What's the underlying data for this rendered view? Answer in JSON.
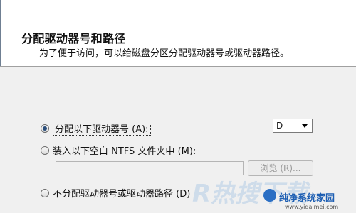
{
  "header": {
    "title": "分配驱动器号和路径",
    "subtitle": "为了便于访问，可以给磁盘分区分配驱动器号或驱动器路径。"
  },
  "options": {
    "assign_letter": {
      "label": "分配以下驱动器号 (A):",
      "selected": true
    },
    "mount_folder": {
      "label": "装入以下空白 NTFS 文件夹中 (M):",
      "selected": false
    },
    "no_assign": {
      "label": "不分配驱动器号或驱动器路径 (D)",
      "selected": false
    }
  },
  "drive_select": {
    "value": "D"
  },
  "folder_path": {
    "value": "",
    "browse_label": "浏览 (R)..."
  },
  "watermark": {
    "mark": "R热搜下载",
    "site_name": "纯净系统家园",
    "site_url": "www.yidaimei.com",
    "color": "#1e5fb3"
  }
}
